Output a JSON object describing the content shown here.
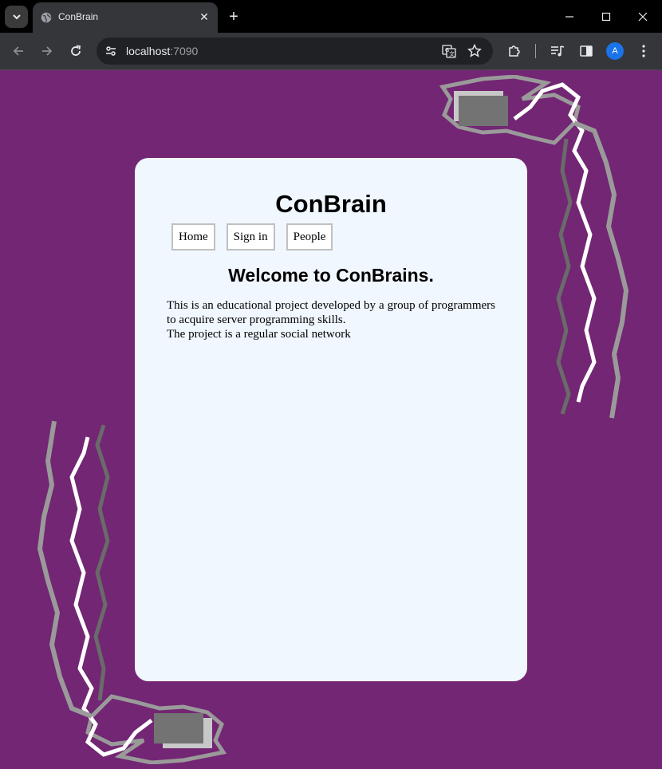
{
  "browser": {
    "tab_title": "ConBrain",
    "url_host": "localhost",
    "url_port": ":7090",
    "avatar_letter": "A"
  },
  "site": {
    "title": "ConBrain",
    "nav": [
      "Home",
      "Sign in",
      "People"
    ],
    "welcome": "Welcome to ConBrains.",
    "description": "This is an educational project developed by a group of programmers to acquire server programming skills.",
    "description2": "The project is a regular social network"
  },
  "colors": {
    "page_background": "#722673",
    "card_background": "#f0f7fe"
  }
}
